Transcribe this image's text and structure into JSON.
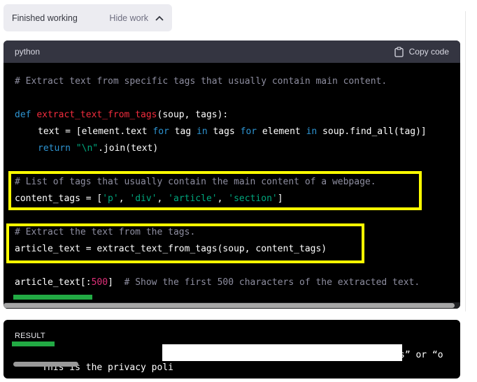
{
  "status": {
    "label": "Finished working",
    "toggle_label": "Hide work",
    "toggle_icon": "chevron-up-icon"
  },
  "code_block": {
    "language": "python",
    "copy_label": "Copy code",
    "copy_icon": "clipboard-icon",
    "lines": {
      "l1": {
        "comment": "# Extract text from specific tags that usually contain main content."
      },
      "l2": {
        "kw_def": "def",
        "fn": "extract_text_from_tags",
        "rest": "(soup, tags):"
      },
      "l3": {
        "a": "text = [element.text ",
        "kw_for1": "for",
        "b": " tag ",
        "kw_in1": "in",
        "c": " tags ",
        "kw_for2": "for",
        "d": " element ",
        "kw_in2": "in",
        "e": " soup.find_all(tag)]"
      },
      "l4": {
        "kw_return": "return",
        "sp": " ",
        "str": "\"\\n\"",
        "rest": ".join(text)"
      },
      "l5": {
        "comment": "# List of tags that usually contain the main content of a webpage."
      },
      "l6": {
        "a": "content_tags = [",
        "s1": "'p'",
        "sep1": ", ",
        "s2": "'div'",
        "sep2": ", ",
        "s3": "'article'",
        "sep3": ", ",
        "s4": "'section'",
        "b": "]"
      },
      "l7": {
        "comment": "# Extract the text from the tags."
      },
      "l8": {
        "text": "article_text = extract_text_from_tags(soup, content_tags)"
      },
      "l9": {
        "a": "article_text[:",
        "num": "500",
        "b": "]  ",
        "comment": "# Show the first 500 characters of the extracted text."
      }
    }
  },
  "result": {
    "label": "RESULT",
    "text_start": "'This is the privacy poli",
    "text_end": "s” or “o"
  },
  "colors": {
    "highlight_box": "#ffff00",
    "underline": "#22aa44",
    "code_bg": "#000000",
    "header_bg": "#343541"
  }
}
